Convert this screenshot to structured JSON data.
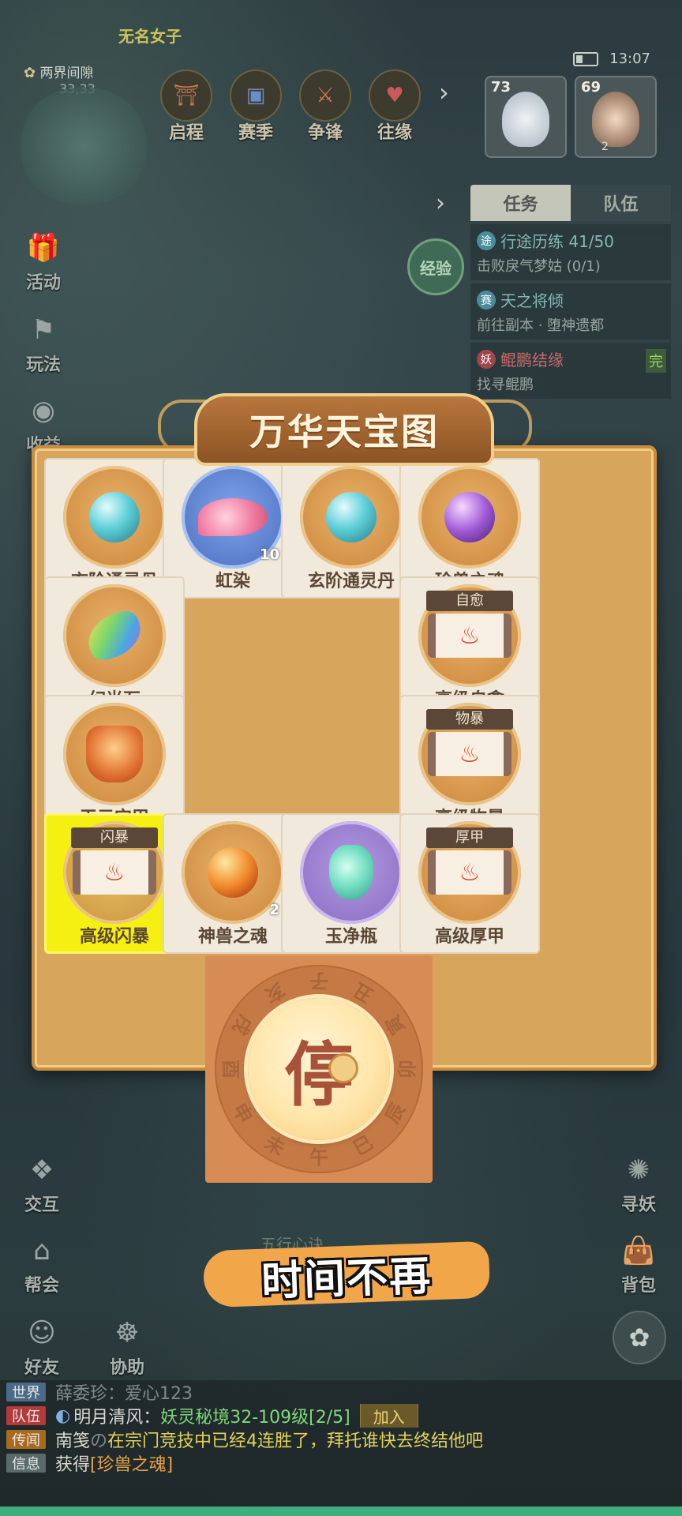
{
  "header": {
    "player_name": "无名女子",
    "time": "13:07",
    "map_name": "两界间隙",
    "map_coords": "33,33"
  },
  "top_nav": [
    {
      "label": "启程",
      "icon": "journey-icon"
    },
    {
      "label": "赛季",
      "icon": "season-icon"
    },
    {
      "label": "争锋",
      "icon": "contest-icon"
    },
    {
      "label": "往缘",
      "icon": "fate-icon"
    }
  ],
  "party": [
    {
      "level": "73"
    },
    {
      "level": "69",
      "badge": "2"
    }
  ],
  "task_panel": {
    "tabs": [
      "任务",
      "队伍"
    ],
    "tasks": [
      {
        "badge": "途",
        "title": "行途历练 41/50",
        "desc": "击败戾气梦姑 (0/1)"
      },
      {
        "badge": "赛",
        "title": "天之将倾",
        "desc": "前往副本 · 堕神遗都"
      },
      {
        "badge": "妖",
        "title": "鲲鹏结缘",
        "desc": "找寻鲲鹏",
        "flag": "完"
      }
    ]
  },
  "exp_label": "经验",
  "left_side": [
    {
      "label": "活动",
      "icon": "gift-icon"
    },
    {
      "label": "玩法",
      "icon": "flag-icon"
    },
    {
      "label": "收益",
      "icon": "money-bag-icon"
    }
  ],
  "board": {
    "title": "万华天宝图",
    "stop_label": "停",
    "zodiac": [
      "子",
      "丑",
      "寅",
      "卯",
      "辰",
      "巳",
      "午",
      "未",
      "申",
      "酉",
      "戌",
      "亥"
    ],
    "cells": [
      {
        "name": "玄阶通灵丹",
        "art": "orb",
        "disc": "gold"
      },
      {
        "name": "虹染",
        "art": "jelly",
        "disc": "blue",
        "qty": "10"
      },
      {
        "name": "玄阶通灵丹",
        "art": "orb",
        "disc": "gold"
      },
      {
        "name": "珍兽之魂",
        "art": "orb-purple",
        "disc": "gold"
      },
      {
        "name": "幻光石",
        "art": "gem",
        "disc": "gold"
      },
      {
        "name": "高级自愈",
        "art": "scroll",
        "disc": "gold",
        "tag": "自愈"
      },
      {
        "name": "天元宝甲",
        "art": "armor",
        "disc": "gold"
      },
      {
        "name": "高级物暴",
        "art": "scroll",
        "disc": "gold",
        "tag": "物暴"
      },
      {
        "name": "高级闪暴",
        "art": "scroll",
        "disc": "gold",
        "tag": "闪暴",
        "selected": true
      },
      {
        "name": "神兽之魂",
        "art": "orb-fire",
        "disc": "gold",
        "qty": "2"
      },
      {
        "name": "玉净瓶",
        "art": "vase",
        "disc": "purple"
      },
      {
        "name": "高级厚甲",
        "art": "scroll",
        "disc": "gold",
        "tag": "厚甲"
      }
    ]
  },
  "banner": {
    "text": "时间不再",
    "hint": "五行心诀"
  },
  "bottom_left": [
    {
      "label": "交互",
      "icon": "interact-icon"
    },
    {
      "label": "帮会",
      "icon": "guild-icon"
    },
    {
      "label": "好友",
      "icon": "friends-icon"
    },
    {
      "label": "协助",
      "icon": "assist-icon"
    }
  ],
  "bottom_right": [
    {
      "label": "寻妖",
      "icon": "seek-demon-icon"
    },
    {
      "label": "背包",
      "icon": "bag-icon"
    }
  ],
  "chat": {
    "lines": [
      {
        "channel": "世界",
        "parts": [
          "薛委珍：",
          "爱心123"
        ]
      },
      {
        "channel": "队伍",
        "parts": [
          "明月清风：",
          "妖灵秘境32-109级[2/5]"
        ],
        "button": "加入"
      },
      {
        "channel": "传闻",
        "parts": [
          "南笺",
          "の",
          "在宗门竞技中已经4连胜了，拜托谁快去终结他吧"
        ]
      },
      {
        "channel": "信息",
        "parts": [
          "获得",
          "[珍兽之魂]"
        ]
      }
    ]
  }
}
